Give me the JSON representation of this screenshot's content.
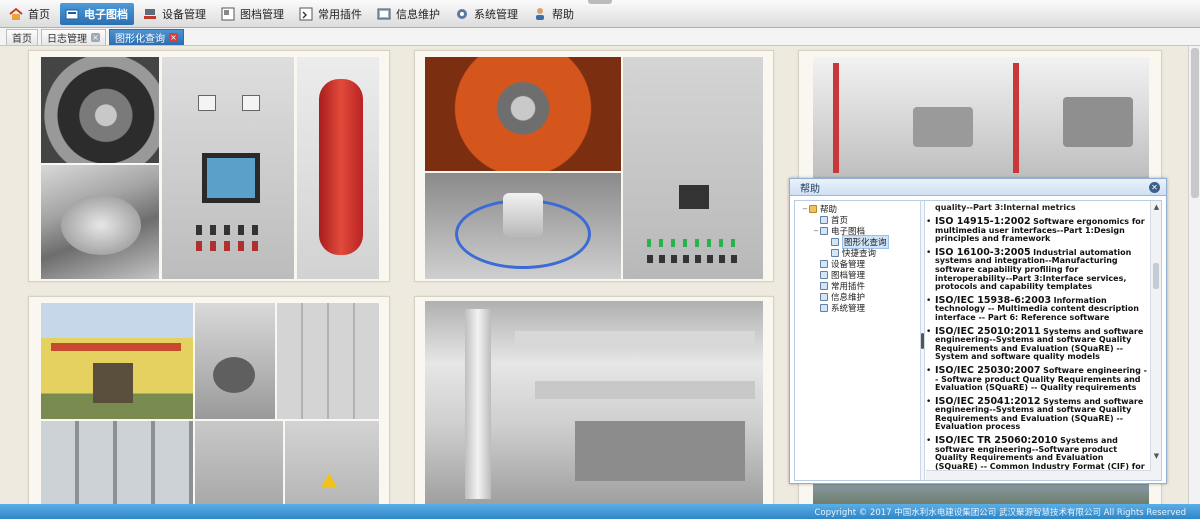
{
  "menu": {
    "items": [
      {
        "label": "首页",
        "icon": "home-icon",
        "active": false
      },
      {
        "label": "电子图档",
        "icon": "folder-icon",
        "active": true
      },
      {
        "label": "设备管理",
        "icon": "equipment-icon",
        "active": false
      },
      {
        "label": "图档管理",
        "icon": "drawing-icon",
        "active": false
      },
      {
        "label": "常用插件",
        "icon": "plugin-icon",
        "active": false
      },
      {
        "label": "信息维护",
        "icon": "maintenance-icon",
        "active": false
      },
      {
        "label": "系统管理",
        "icon": "gear-icon",
        "active": false
      },
      {
        "label": "帮助",
        "icon": "user-help-icon",
        "active": false
      }
    ]
  },
  "tabs": [
    {
      "label": "首页",
      "closable": false,
      "active": false
    },
    {
      "label": "日志管理",
      "closable": true,
      "active": false
    },
    {
      "label": "图形化查询",
      "closable": true,
      "active": true
    }
  ],
  "dialog": {
    "title": "帮助",
    "tree": [
      {
        "label": "帮助",
        "level": 0,
        "type": "root"
      },
      {
        "label": "首页",
        "level": 1
      },
      {
        "label": "电子图档",
        "level": 1
      },
      {
        "label": "图形化查询",
        "level": 2,
        "selected": true
      },
      {
        "label": "快捷查询",
        "level": 2
      },
      {
        "label": "设备管理",
        "level": 1
      },
      {
        "label": "图档管理",
        "level": 1
      },
      {
        "label": "常用插件",
        "level": 1
      },
      {
        "label": "信息维护",
        "level": 1
      },
      {
        "label": "系统管理",
        "level": 1
      }
    ],
    "fragment": "quality--Part 3:Internal metrics",
    "entries": [
      {
        "code": "ISO 14915-1:2002",
        "desc": "Software ergonomics for multimedia user interfaces--Part 1:Design principles and framework"
      },
      {
        "code": "ISO 16100-3:2005",
        "desc": "Industrial automation systems and integration--Manufacturing software capability profiling for interoperability--Part 3:Interface services, protocols and capability templates"
      },
      {
        "code": "ISO/IEC 15938-6:2003",
        "desc": "Information technology -- Multimedia content description interface -- Part 6: Reference software"
      },
      {
        "code": "ISO/IEC 25010:2011",
        "desc": "Systems and software engineering--Systems and software Quality Requirements and Evaluation (SQuaRE) -- System and software quality models"
      },
      {
        "code": "ISO/IEC 25030:2007",
        "desc": "Software engineering -- Software product Quality Requirements and Evaluation (SQuaRE) -- Quality requirements"
      },
      {
        "code": "ISO/IEC 25041:2012",
        "desc": "Systems and software engineering--Systems and software Quality Requirements and Evaluation (SQuaRE) -- Evaluation process"
      },
      {
        "code": "ISO/IEC TR 25060:2010",
        "desc": "Systems and software engineering--Software product Quality Requirements and Evaluation (SQuaRE) -- Common Industry Format (CIF) for usability: User needs report"
      }
    ]
  },
  "footer": {
    "copyright": "Copyright © 2017 中国水利水电建设集团公司 武汉聚源智慧技术有限公司 All Rights Reserved"
  },
  "colors": {
    "accent": "#2a6fb3",
    "footer": "#3a90cf",
    "background": "#eeeae0"
  }
}
